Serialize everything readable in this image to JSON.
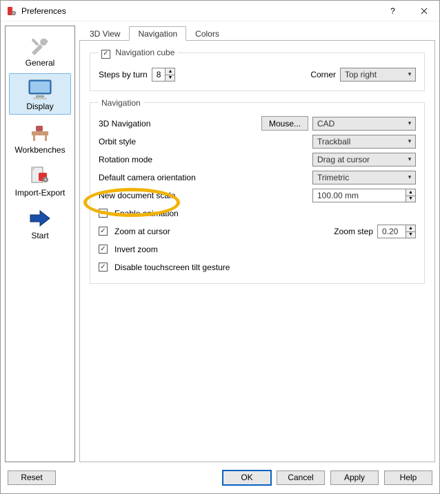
{
  "window": {
    "title": "Preferences"
  },
  "sidebar": {
    "items": [
      {
        "label": "General"
      },
      {
        "label": "Display"
      },
      {
        "label": "Workbenches"
      },
      {
        "label": "Import-Export"
      },
      {
        "label": "Start"
      }
    ]
  },
  "tabs": [
    {
      "label": "3D View"
    },
    {
      "label": "Navigation"
    },
    {
      "label": "Colors"
    }
  ],
  "navcube": {
    "legend": "Navigation cube",
    "steps_label": "Steps by turn",
    "steps_value": "8",
    "corner_label": "Corner",
    "corner_value": "Top right"
  },
  "navigation": {
    "legend": "Navigation",
    "nav3d_label": "3D Navigation",
    "mouse_btn": "Mouse...",
    "nav3d_value": "CAD",
    "orbit_label": "Orbit style",
    "orbit_value": "Trackball",
    "rot_label": "Rotation mode",
    "rot_value": "Drag at cursor",
    "camera_label": "Default camera orientation",
    "camera_value": "Trimetric",
    "scale_label": "New document scale",
    "scale_value": "100.00 mm",
    "enable_anim": "Enable animation",
    "zoom_cursor": "Zoom at cursor",
    "zoom_step_label": "Zoom step",
    "zoom_step_value": "0.20",
    "invert_zoom": "Invert zoom",
    "disable_tilt": "Disable touchscreen tilt gesture"
  },
  "footer": {
    "reset": "Reset",
    "ok": "OK",
    "cancel": "Cancel",
    "apply": "Apply",
    "help": "Help"
  }
}
